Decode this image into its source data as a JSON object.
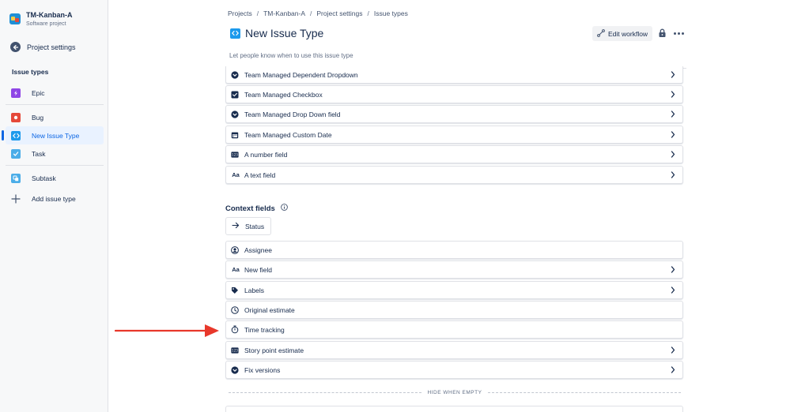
{
  "sidebar": {
    "project_name": "TM-Kanban-A",
    "project_type": "Software project",
    "back_label": "Project settings",
    "section_title": "Issue types",
    "items": [
      {
        "label": "Epic",
        "icon": "epic-icon",
        "color": "#8f46e6"
      },
      {
        "label": "Bug",
        "icon": "bug-icon",
        "color": "#e5493a"
      },
      {
        "label": "New Issue Type",
        "icon": "code-icon",
        "color": "#1d9aec",
        "active": true
      },
      {
        "label": "Task",
        "icon": "task-icon",
        "color": "#4bade8"
      },
      {
        "label": "Subtask",
        "icon": "subtask-icon",
        "color": "#4bade8"
      },
      {
        "label": "Add issue type",
        "icon": "plus-icon"
      }
    ]
  },
  "breadcrumb": [
    "Projects",
    "TM-Kanban-A",
    "Project settings",
    "Issue types"
  ],
  "header": {
    "title": "New Issue Type",
    "edit_workflow_label": "Edit workflow",
    "description_placeholder": "Let people know when to use this issue type"
  },
  "fields": [
    {
      "label": "Team Managed Dependent Dropdown",
      "icon": "dropdown-icon"
    },
    {
      "label": "Team Managed Checkbox",
      "icon": "checkbox-icon"
    },
    {
      "label": "Team Managed Drop Down field",
      "icon": "dropdown-icon"
    },
    {
      "label": "Team Managed Custom Date",
      "icon": "calendar-icon"
    },
    {
      "label": "A number field",
      "icon": "number-icon"
    },
    {
      "label": "A text field",
      "icon": "text-icon"
    }
  ],
  "context": {
    "title": "Context fields",
    "status_label": "Status",
    "fields": [
      {
        "label": "Assignee",
        "icon": "user-icon",
        "chevron": false
      },
      {
        "label": "New field",
        "icon": "text-icon",
        "chevron": true
      },
      {
        "label": "Labels",
        "icon": "tag-icon",
        "chevron": true
      },
      {
        "label": "Original estimate",
        "icon": "clock-icon",
        "chevron": false
      },
      {
        "label": "Time tracking",
        "icon": "stopwatch-icon",
        "chevron": false
      },
      {
        "label": "Story point estimate",
        "icon": "number-icon",
        "chevron": true
      },
      {
        "label": "Fix versions",
        "icon": "dropdown-icon",
        "chevron": true
      }
    ],
    "hide_when_empty": "HIDE WHEN EMPTY"
  },
  "colors": {
    "accent": "#0c66e4",
    "arrow": "#e8382b"
  }
}
